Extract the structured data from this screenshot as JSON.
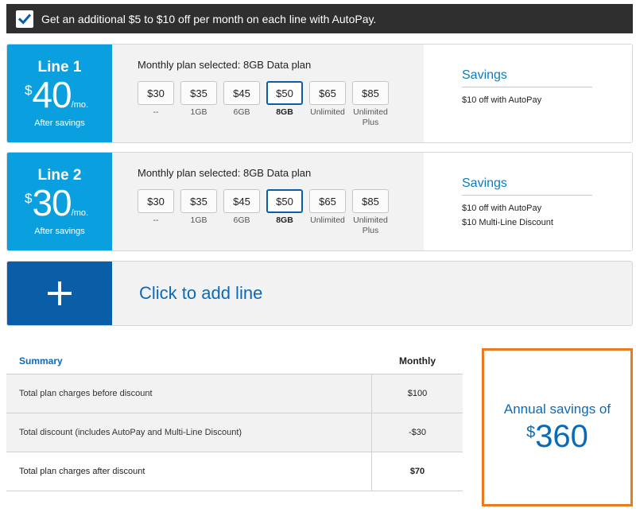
{
  "banner": {
    "autopay_text": "Get an additional $5 to $10 off per month on each line with AutoPay.",
    "checked": true
  },
  "plan_options": [
    {
      "price": "$30",
      "label": "--"
    },
    {
      "price": "$35",
      "label": "1GB"
    },
    {
      "price": "$45",
      "label": "6GB"
    },
    {
      "price": "$50",
      "label": "8GB"
    },
    {
      "price": "$65",
      "label": "Unlimited"
    },
    {
      "price": "$85",
      "label": "Unlimited Plus"
    }
  ],
  "lines": [
    {
      "name": "Line 1",
      "currency": "$",
      "price": "40",
      "unit": "/mo.",
      "after": "After savings",
      "plan_selected": "Monthly plan selected: 8GB Data plan",
      "selected_index": 3,
      "savings_title": "Savings",
      "savings_items": [
        "$10 off with AutoPay"
      ]
    },
    {
      "name": "Line 2",
      "currency": "$",
      "price": "30",
      "unit": "/mo.",
      "after": "After savings",
      "plan_selected": "Monthly plan selected: 8GB Data plan",
      "selected_index": 3,
      "savings_title": "Savings",
      "savings_items": [
        "$10 off with AutoPay",
        "$10 Multi-Line Discount"
      ]
    }
  ],
  "add_line": {
    "label": "Click to add line",
    "icon": "plus-icon"
  },
  "summary": {
    "header_label": "Summary",
    "header_monthly": "Monthly",
    "rows": [
      {
        "label": "Total plan charges before discount",
        "value": "$100"
      },
      {
        "label": "Total discount (includes AutoPay and Multi-Line Discount)",
        "value": "-$30"
      },
      {
        "label": "Total plan charges after discount",
        "value": "$70"
      }
    ]
  },
  "annual": {
    "label": "Annual savings of",
    "currency": "$",
    "amount": "360"
  },
  "colors": {
    "line_badge": "#0aa0e0",
    "add_badge": "#0a5ea8",
    "accent_text": "#0a6ab8",
    "annual_border": "#e87b1e",
    "banner_bg": "#2f2f2f"
  }
}
